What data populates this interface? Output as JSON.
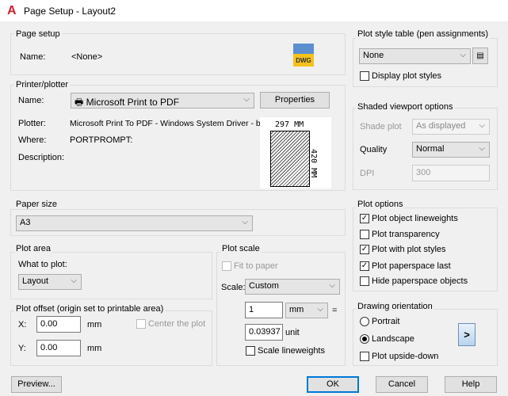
{
  "window": {
    "title": "Page Setup - Layout2"
  },
  "page_setup": {
    "label": "Page setup",
    "name_label": "Name:",
    "name_value": "<None>"
  },
  "printer": {
    "label": "Printer/plotter",
    "name_label": "Name:",
    "name_value": "Microsoft Print to PDF",
    "properties": "Properties",
    "plotter_label": "Plotter:",
    "plotter_value": "Microsoft Print To PDF - Windows System Driver - b...",
    "where_label": "Where:",
    "where_value": "PORTPROMPT:",
    "description_label": "Description:",
    "preview_width": "297 MM",
    "preview_height": "420 MM"
  },
  "paper_size": {
    "label": "Paper size",
    "value": "A3"
  },
  "plot_area": {
    "label": "Plot area",
    "what_label": "What to plot:",
    "what_value": "Layout"
  },
  "plot_offset": {
    "label": "Plot offset (origin set to printable area)",
    "x_label": "X:",
    "x_value": "0.00",
    "y_label": "Y:",
    "y_value": "0.00",
    "unit": "mm",
    "center": "Center the plot"
  },
  "plot_scale": {
    "label": "Plot scale",
    "fit": "Fit to paper",
    "scale_label": "Scale:",
    "scale_value": "Custom",
    "value1": "1",
    "unit1": "mm",
    "equals": "=",
    "value2": "0.03937",
    "unit2": "unit",
    "scale_lw": "Scale lineweights"
  },
  "plot_style": {
    "label": "Plot style table (pen assignments)",
    "value": "None",
    "display": "Display plot styles"
  },
  "shaded": {
    "label": "Shaded viewport options",
    "shade_label": "Shade plot",
    "shade_value": "As displayed",
    "quality_label": "Quality",
    "quality_value": "Normal",
    "dpi_label": "DPI",
    "dpi_value": "300"
  },
  "plot_options": {
    "label": "Plot options",
    "items": [
      {
        "label": "Plot object lineweights",
        "checked": true
      },
      {
        "label": "Plot transparency",
        "checked": false
      },
      {
        "label": "Plot with plot styles",
        "checked": true
      },
      {
        "label": "Plot paperspace last",
        "checked": true
      },
      {
        "label": "Hide paperspace objects",
        "checked": false
      }
    ]
  },
  "orientation": {
    "label": "Drawing orientation",
    "portrait": "Portrait",
    "landscape": "Landscape",
    "upside": "Plot upside-down",
    "selected": "Landscape"
  },
  "buttons": {
    "preview": "Preview...",
    "ok": "OK",
    "cancel": "Cancel",
    "help": "Help"
  }
}
